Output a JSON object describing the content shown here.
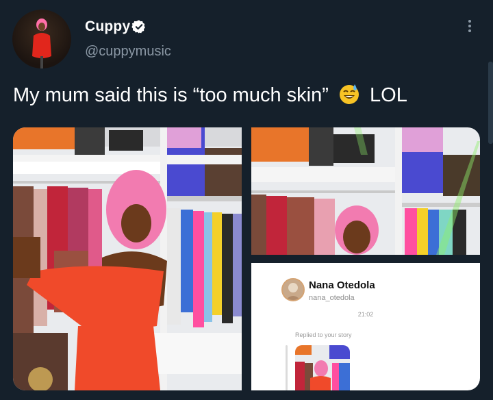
{
  "tweet": {
    "display_name": "Cuppy",
    "handle": "@cuppymusic",
    "text_before": "My mum said this is “too much skin”",
    "text_after": "LOL",
    "verified": true
  },
  "instagram_reply": {
    "name": "Nana Otedola",
    "handle": "nana_otedola",
    "time": "21:02",
    "replied_label": "Replied to your story"
  },
  "colors": {
    "background": "#15202b",
    "secondary_text": "#8b98a5",
    "verified_badge": "#ffffff"
  },
  "icons": {
    "verified": "verified-badge-icon",
    "more": "more-options-icon",
    "emoji": "grinning-face-with-sweat-emoji"
  }
}
